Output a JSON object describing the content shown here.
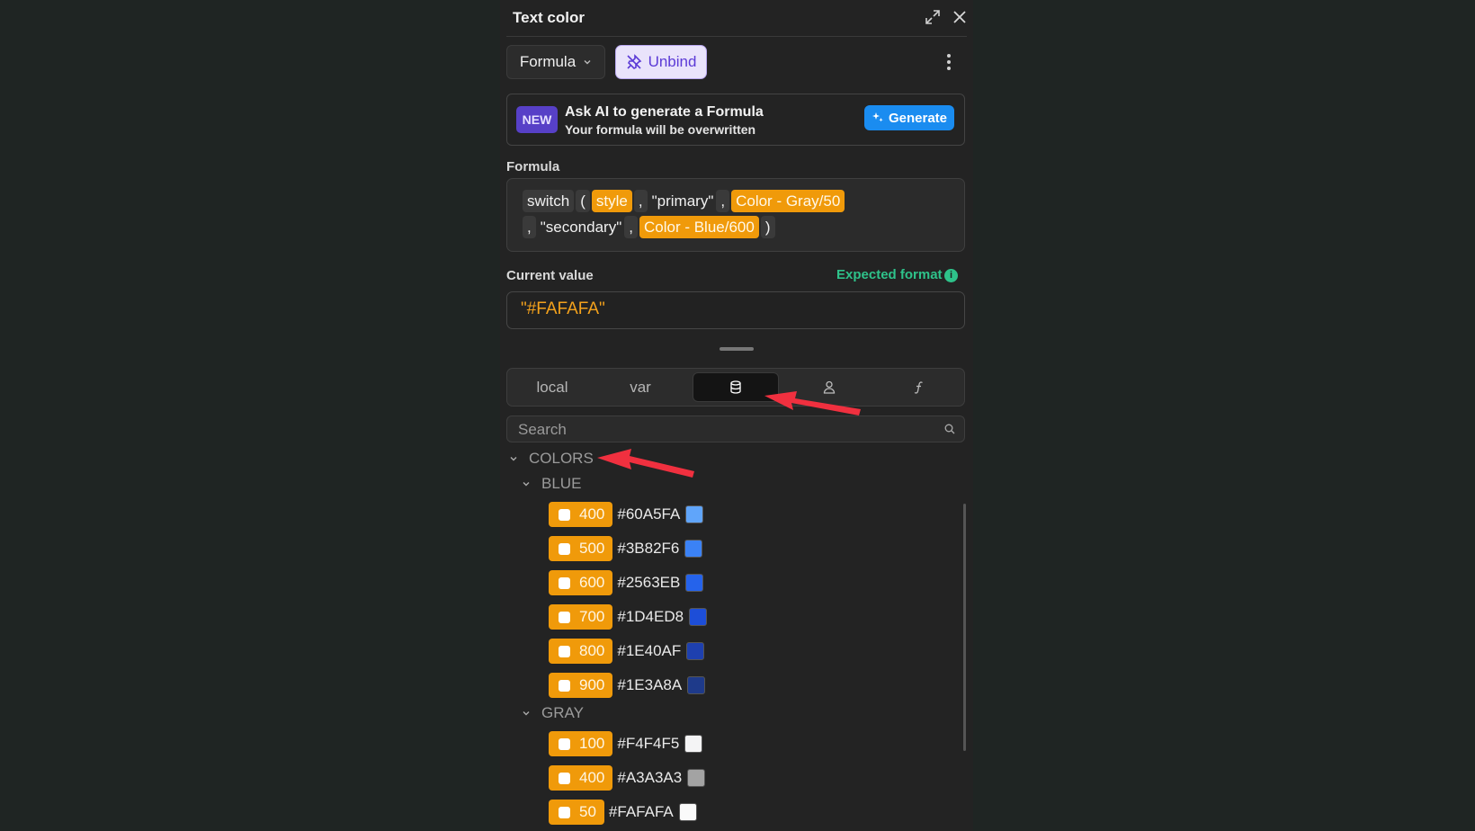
{
  "header": {
    "title": "Text color"
  },
  "toolbar": {
    "formula_label": "Formula",
    "unbind_label": "Unbind"
  },
  "ai": {
    "badge": "NEW",
    "title": "Ask AI to generate a Formula",
    "subtitle": "Your formula will be overwritten",
    "generate_label": "Generate"
  },
  "formula": {
    "label": "Formula",
    "tokens": {
      "switch": "switch",
      "open": "(",
      "style": "style",
      "comma1": ",",
      "primary": "\"primary\"",
      "comma2": ",",
      "gray": "Color - Gray/50",
      "comma3": ",",
      "secondary": "\"secondary\"",
      "comma4": ",",
      "blue": "Color - Blue/600",
      "close": ")"
    }
  },
  "current_value": {
    "label": "Current value",
    "expected_format": "Expected format",
    "value": "\"#FAFAFA\""
  },
  "tabs": [
    {
      "label": "local"
    },
    {
      "label": "var"
    },
    {
      "icon": "database-icon",
      "active": true
    },
    {
      "icon": "user-icon"
    },
    {
      "icon": "function-icon"
    }
  ],
  "search": {
    "placeholder": "Search"
  },
  "tree": {
    "root": "COLORS",
    "groups": [
      {
        "name": "BLUE",
        "items": [
          {
            "shade": "400",
            "hex": "#60A5FA",
            "color": "#60A5FA"
          },
          {
            "shade": "500",
            "hex": "#3B82F6",
            "color": "#3B82F6"
          },
          {
            "shade": "600",
            "hex": "#2563EB",
            "color": "#2563EB"
          },
          {
            "shade": "700",
            "hex": "#1D4ED8",
            "color": "#1D4ED8"
          },
          {
            "shade": "800",
            "hex": "#1E40AF",
            "color": "#1E40AF"
          },
          {
            "shade": "900",
            "hex": "#1E3A8A",
            "color": "#1E3A8A"
          }
        ]
      },
      {
        "name": "GRAY",
        "items": [
          {
            "shade": "100",
            "hex": "#F4F4F5",
            "color": "#F4F4F5"
          },
          {
            "shade": "400",
            "hex": "#A3A3A3",
            "color": "#A3A3A3"
          },
          {
            "shade": "50",
            "hex": "#FAFAFA",
            "color": "#FAFAFA"
          }
        ]
      }
    ]
  },
  "colors": {
    "accent": "#F09A0A",
    "unbind": "#5B3AD6",
    "generate": "#1A8CF0",
    "expected": "#2EC28A",
    "annotation_arrow": "#F0303F"
  }
}
